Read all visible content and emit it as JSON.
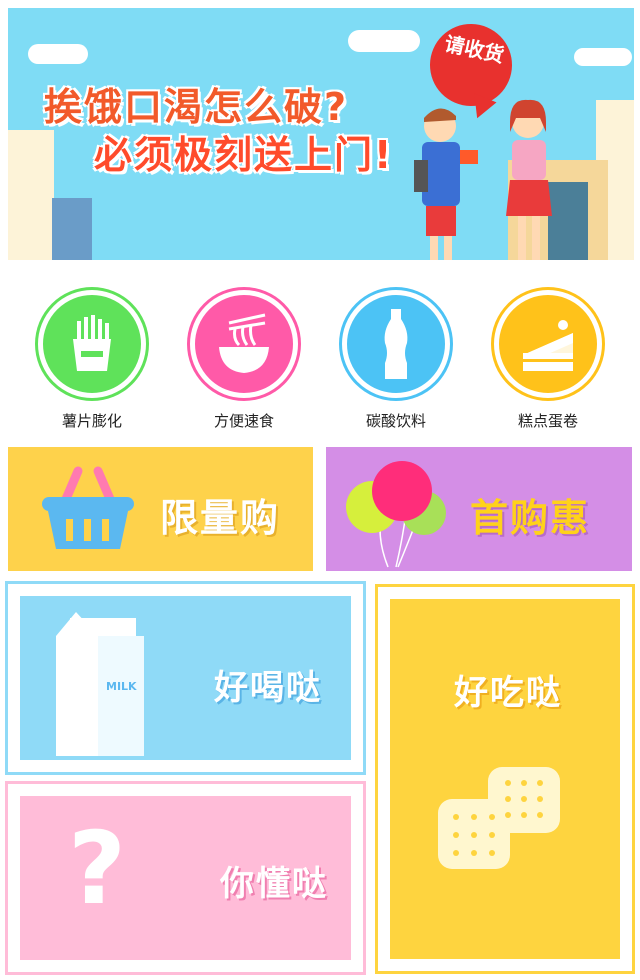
{
  "banner": {
    "headline_line1": "挨饿口渴怎么破?",
    "headline_line2": "必须极刻送上门!",
    "bubble_text": "请收货"
  },
  "categories": [
    {
      "label": "薯片膨化",
      "icon": "fries-icon",
      "color": "#5fe25a"
    },
    {
      "label": "方便速食",
      "icon": "noodles-icon",
      "color": "#ff5aa8"
    },
    {
      "label": "碳酸饮料",
      "icon": "soda-bottle-icon",
      "color": "#4cc3f5"
    },
    {
      "label": "糕点蛋卷",
      "icon": "cake-icon",
      "color": "#ffc21a"
    }
  ],
  "promos": {
    "limited": {
      "label": "限量购",
      "bg": "#fed24b"
    },
    "first_buy": {
      "label": "首购惠",
      "bg": "#d48ee6"
    }
  },
  "cards": {
    "drinks": {
      "label": "好喝哒",
      "milk_text": "MILK",
      "bg": "#8fdaf7"
    },
    "snacks": {
      "label": "好吃哒",
      "bg": "#fed43f"
    },
    "mystery": {
      "label": "你懂哒",
      "bg": "#ffbcd8"
    }
  }
}
